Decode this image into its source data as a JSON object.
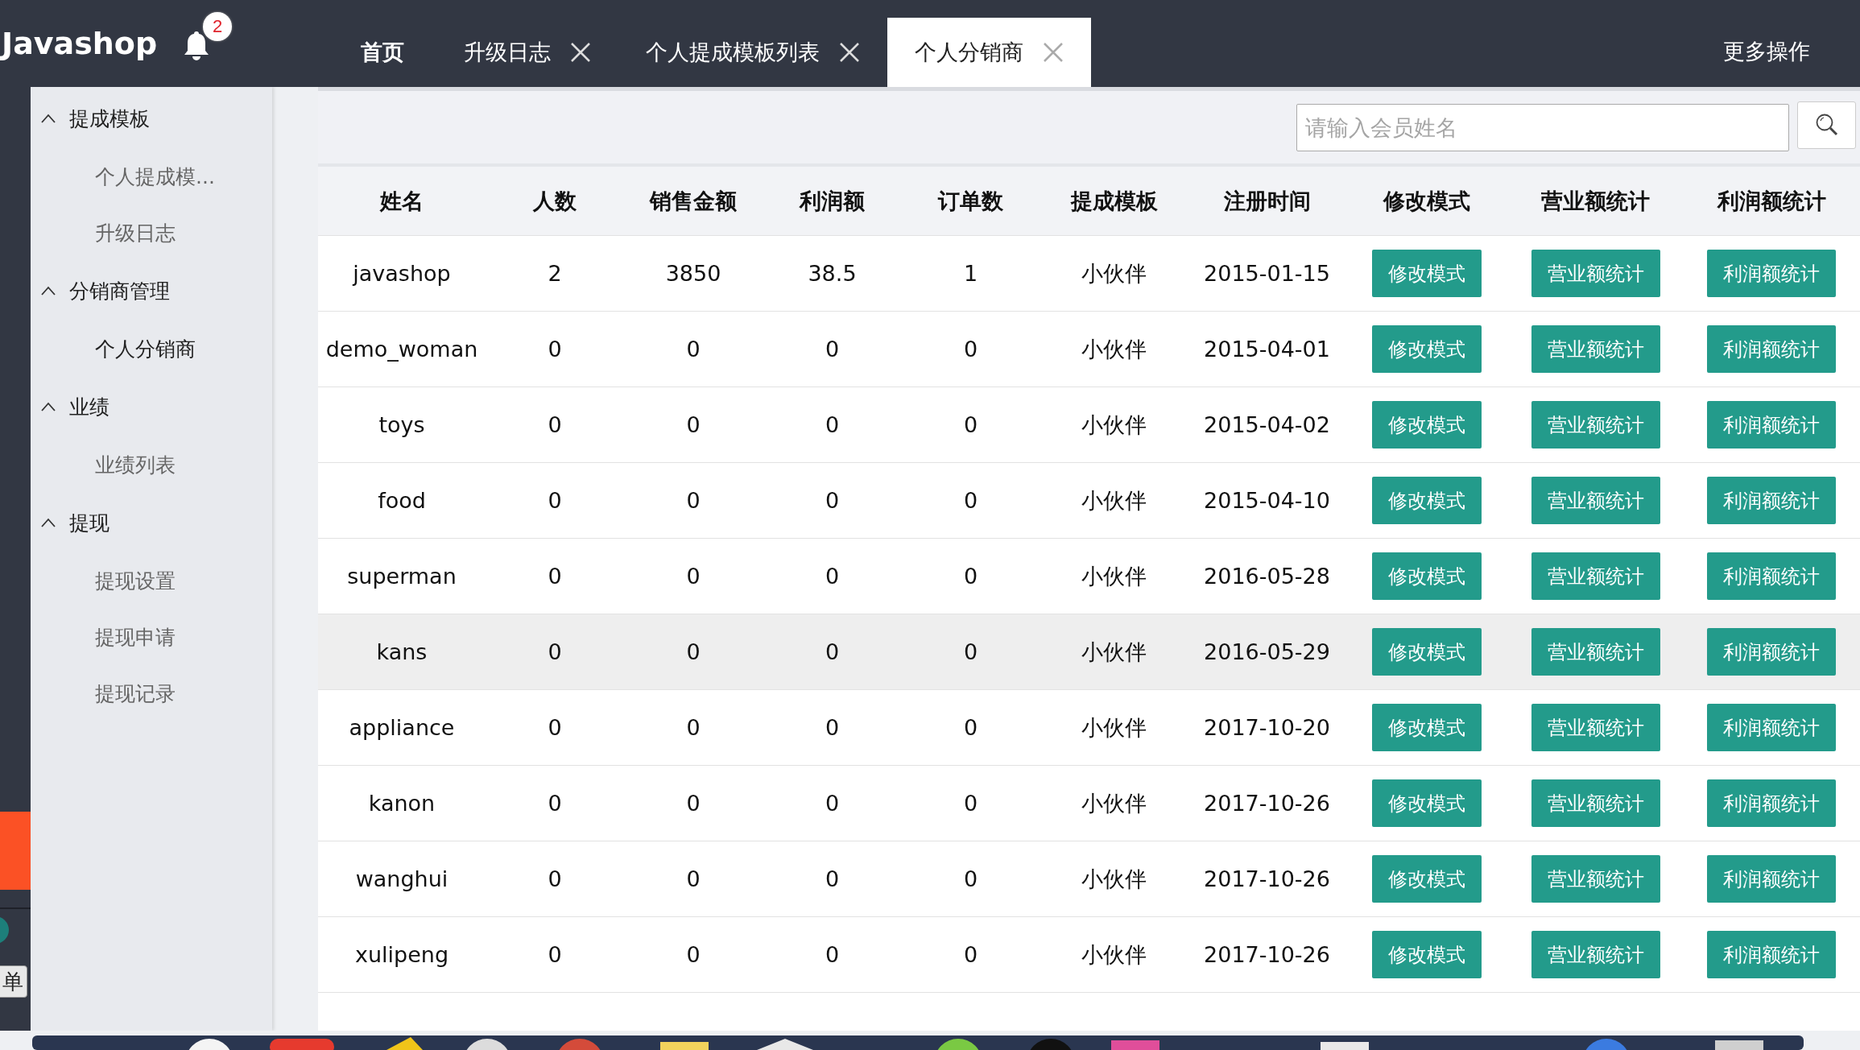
{
  "app": {
    "logo": "Javashop",
    "notifications": "2"
  },
  "tabs": [
    {
      "label": "首页",
      "selected": false,
      "closable": false
    },
    {
      "label": "升级日志",
      "selected": false,
      "closable": true
    },
    {
      "label": "个人提成模板列表",
      "selected": false,
      "closable": true
    },
    {
      "label": "个人分销商",
      "selected": true,
      "closable": true
    }
  ],
  "more_actions": "更多操作",
  "outer_sidebar": {
    "button": "单"
  },
  "sidebar": {
    "groups": [
      {
        "title": "提成模板",
        "expanded": true,
        "items": [
          {
            "label": "个人提成模...",
            "selected": false
          },
          {
            "label": "升级日志",
            "selected": false
          }
        ]
      },
      {
        "title": "分销商管理",
        "expanded": true,
        "items": [
          {
            "label": "个人分销商",
            "selected": true
          }
        ]
      },
      {
        "title": "业绩",
        "expanded": true,
        "items": [
          {
            "label": "业绩列表",
            "selected": false
          }
        ]
      },
      {
        "title": "提现",
        "expanded": true,
        "items": [
          {
            "label": "提现设置",
            "selected": false
          },
          {
            "label": "提现申请",
            "selected": false
          },
          {
            "label": "提现记录",
            "selected": false
          }
        ]
      }
    ]
  },
  "search": {
    "placeholder": "请输入会员姓名"
  },
  "table": {
    "columns": [
      "姓名",
      "人数",
      "销售金额",
      "利润额",
      "订单数",
      "提成模板",
      "注册时间",
      "修改模式",
      "营业额统计",
      "利润额统计"
    ],
    "rows": [
      {
        "hovered": false,
        "cells": [
          "javashop",
          "2",
          "3850",
          "38.5",
          "1",
          "小伙伴",
          "2015-01-15"
        ],
        "actions": [
          "修改模式",
          "营业额统计",
          "利润额统计"
        ]
      },
      {
        "hovered": false,
        "cells": [
          "demo_woman",
          "0",
          "0",
          "0",
          "0",
          "小伙伴",
          "2015-04-01"
        ],
        "actions": [
          "修改模式",
          "营业额统计",
          "利润额统计"
        ]
      },
      {
        "hovered": false,
        "cells": [
          "toys",
          "0",
          "0",
          "0",
          "0",
          "小伙伴",
          "2015-04-02"
        ],
        "actions": [
          "修改模式",
          "营业额统计",
          "利润额统计"
        ]
      },
      {
        "hovered": false,
        "cells": [
          "food",
          "0",
          "0",
          "0",
          "0",
          "小伙伴",
          "2015-04-10"
        ],
        "actions": [
          "修改模式",
          "营业额统计",
          "利润额统计"
        ]
      },
      {
        "hovered": false,
        "cells": [
          "superman",
          "0",
          "0",
          "0",
          "0",
          "小伙伴",
          "2016-05-28"
        ],
        "actions": [
          "修改模式",
          "营业额统计",
          "利润额统计"
        ]
      },
      {
        "hovered": true,
        "cells": [
          "kans",
          "0",
          "0",
          "0",
          "0",
          "小伙伴",
          "2016-05-29"
        ],
        "actions": [
          "修改模式",
          "营业额统计",
          "利润额统计"
        ]
      },
      {
        "hovered": false,
        "cells": [
          "appliance",
          "0",
          "0",
          "0",
          "0",
          "小伙伴",
          "2017-10-20"
        ],
        "actions": [
          "修改模式",
          "营业额统计",
          "利润额统计"
        ]
      },
      {
        "hovered": false,
        "cells": [
          "kanon",
          "0",
          "0",
          "0",
          "0",
          "小伙伴",
          "2017-10-26"
        ],
        "actions": [
          "修改模式",
          "营业额统计",
          "利润额统计"
        ]
      },
      {
        "hovered": false,
        "cells": [
          "wanghui",
          "0",
          "0",
          "0",
          "0",
          "小伙伴",
          "2017-10-26"
        ],
        "actions": [
          "修改模式",
          "营业额统计",
          "利润额统计"
        ]
      },
      {
        "hovered": false,
        "cells": [
          "xulipeng",
          "0",
          "0",
          "0",
          "0",
          "小伙伴",
          "2017-10-26"
        ],
        "actions": [
          "修改模式",
          "营业额统计",
          "利润额统计"
        ]
      }
    ]
  }
}
